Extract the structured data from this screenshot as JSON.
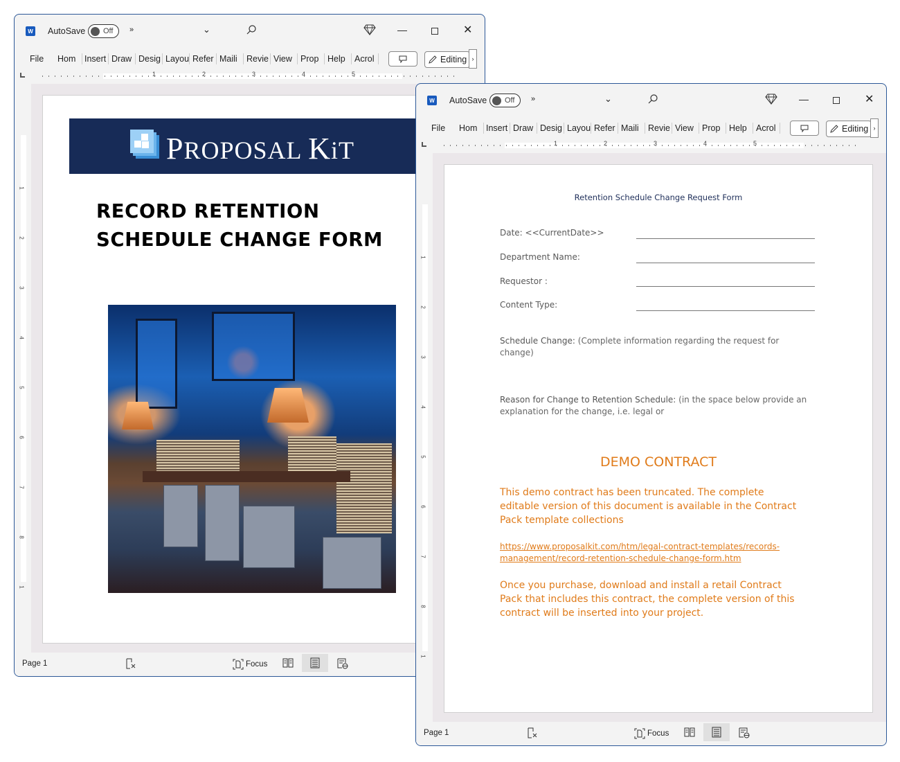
{
  "app": {
    "autosave_label": "AutoSave",
    "autosave_state": "Off",
    "more_glyph": "»",
    "chevron_glyph": "⌄",
    "minimize_glyph": "—",
    "close_glyph": "✕",
    "tabs": [
      "File",
      "Hom",
      "Insert",
      "Draw",
      "Desig",
      "Layou",
      "Refer",
      "Maili",
      "Revie",
      "View",
      "Prop",
      "Help",
      "Acrol"
    ],
    "comment_glyph": "🗩",
    "editing_label": "Editing",
    "editing_more_glyph": "›",
    "ruler_numbers": [
      "1",
      "2",
      "3",
      "4",
      "5"
    ],
    "vruler_numbers": [
      "1",
      "2",
      "3",
      "4",
      "5",
      "6",
      "7",
      "8",
      "1"
    ],
    "status": {
      "page": "Page 1",
      "focus": "Focus"
    }
  },
  "window1": {
    "logo_text_big_P": "P",
    "logo_text_rest": "ROPOSAL ",
    "logo_text_big_K": "K",
    "logo_text_iT": "iT",
    "cover_title_line1": "RECORD RETENTION",
    "cover_title_line2": "SCHEDULE CHANGE FORM",
    "photo_alt": "Records office with stacks of files and boxes at night",
    "colors": {
      "banner": "#172b57"
    }
  },
  "window2": {
    "form_title": "Retention Schedule Change Request Form",
    "fields": [
      {
        "label": "Date: <<CurrentDate>>"
      },
      {
        "label": "Department Name:"
      },
      {
        "label": "Requestor :"
      },
      {
        "label": "Content Type:"
      }
    ],
    "schedule_change_label": "Schedule Change:",
    "schedule_change_text": " (Complete information regarding the request for change)",
    "reason_label": "Reason for Change to Retention Schedule:",
    "reason_text": "  (in the space below provide an explanation for the change, i.e. legal or",
    "demo_title": "DEMO CONTRACT",
    "demo_text1": "This demo contract has been truncated. The complete editable version of this document is available in the Contract Pack template collections",
    "demo_link": "https://www.proposalkit.com/htm/legal-contract-templates/records-management/record-retention-schedule-change-form.htm",
    "demo_text2": "Once you purchase, download and install a retail Contract Pack that includes this contract, the complete version of this contract will be inserted into your project.",
    "colors": {
      "title": "#1f2f5a",
      "demo": "#e07b1a"
    }
  }
}
